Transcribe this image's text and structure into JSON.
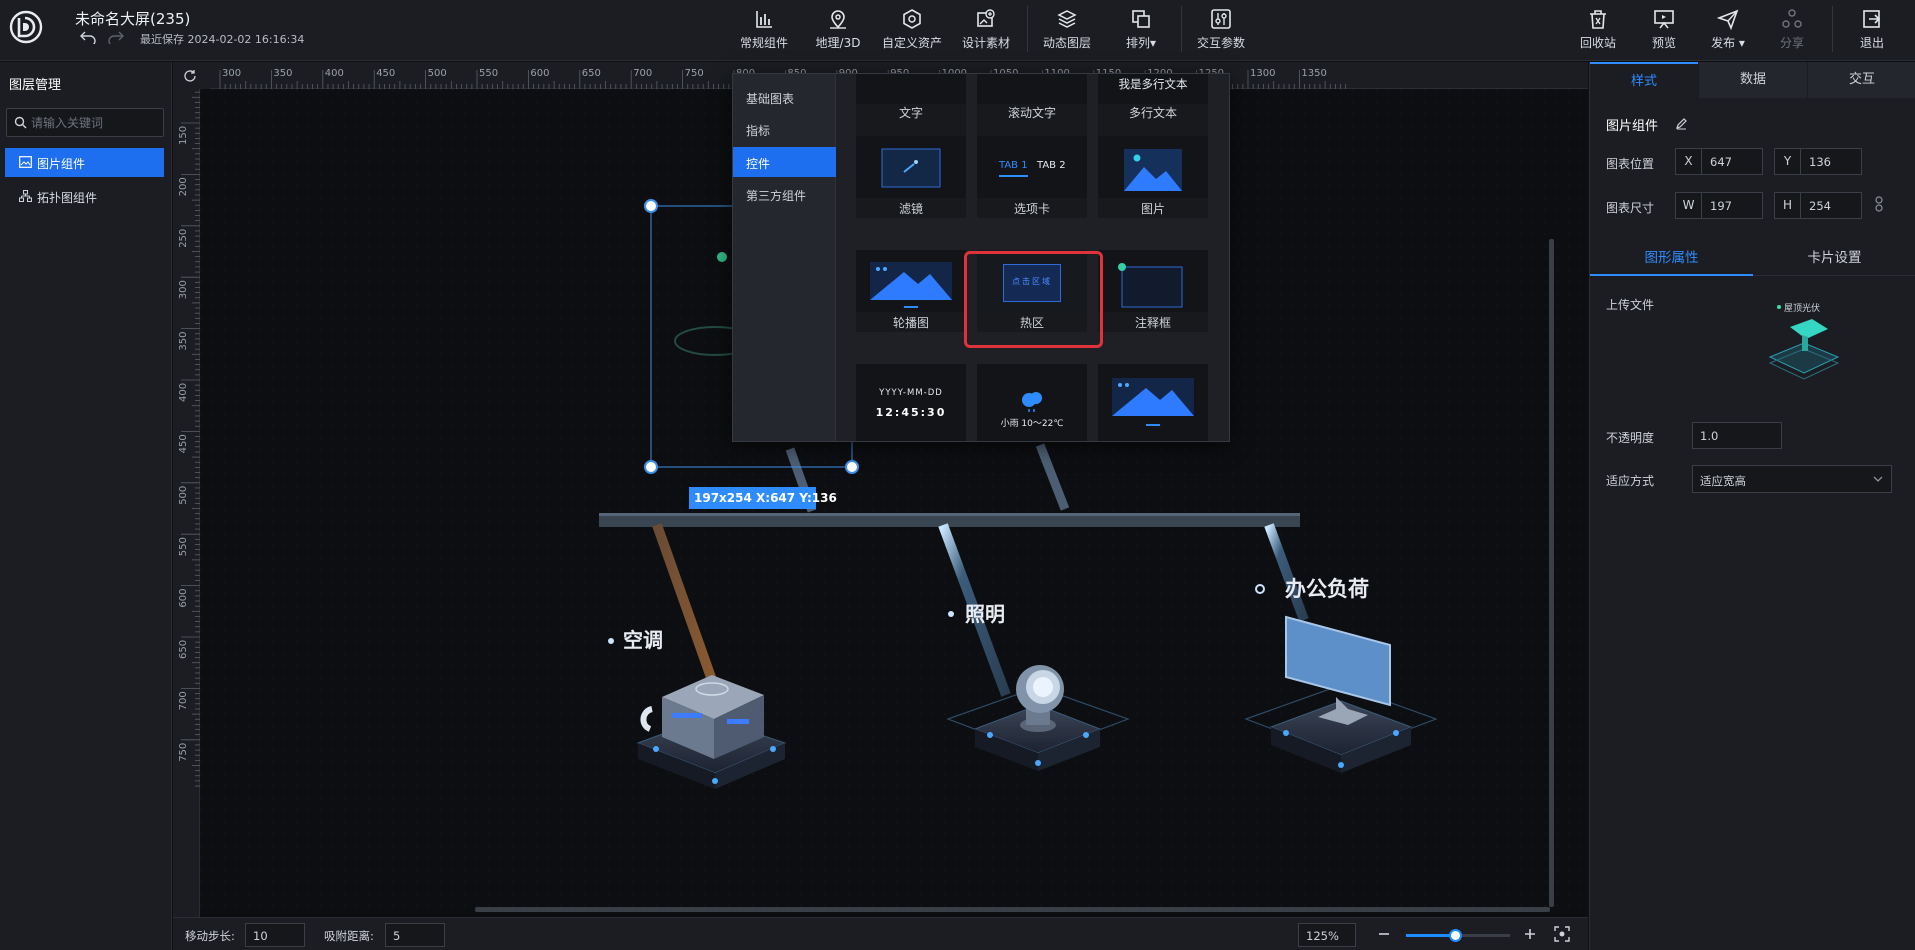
{
  "app": {
    "title": "未命名大屏(235)",
    "saved_text": "最近保存 2024-02-02 16:16:34"
  },
  "toolbar": {
    "center": [
      {
        "label": "常规组件",
        "icon": "bar-chart-icon"
      },
      {
        "label": "地理/3D",
        "icon": "map-pin-icon"
      },
      {
        "label": "自定义资产",
        "icon": "hexagon-icon"
      },
      {
        "label": "设计素材",
        "icon": "image-add-icon"
      },
      {
        "label": "动态图层",
        "icon": "layers-icon"
      },
      {
        "label": "排列▾",
        "icon": "arrange-icon"
      },
      {
        "label": "交互参数",
        "icon": "sliders-icon"
      }
    ],
    "right": [
      {
        "label": "回收站",
        "icon": "trash-icon"
      },
      {
        "label": "预览",
        "icon": "monitor-icon"
      },
      {
        "label": "发布 ▾",
        "icon": "send-icon"
      },
      {
        "label": "分享",
        "icon": "share-icon"
      },
      {
        "label": "退出",
        "icon": "exit-icon"
      }
    ]
  },
  "left_panel": {
    "title": "图层管理",
    "search_placeholder": "请输入关键词",
    "layers": [
      {
        "label": "图片组件",
        "active": true
      },
      {
        "label": "拓扑图组件",
        "active": false
      }
    ]
  },
  "ruler": {
    "x_ticks": [
      "300",
      "350",
      "400",
      "450",
      "500",
      "550",
      "600",
      "650",
      "700",
      "750",
      "800",
      "850",
      "900",
      "950",
      "1000",
      "1050",
      "1100",
      "1150",
      "1200",
      "1250",
      "1300",
      "1350"
    ],
    "y_ticks": [
      "150",
      "200",
      "250",
      "300",
      "350",
      "400",
      "450",
      "500",
      "550",
      "600",
      "650",
      "700",
      "750"
    ]
  },
  "canvas": {
    "selection_label": "197x254   X:647 Y:136",
    "nodes": [
      "空调",
      "照明",
      "办公负荷"
    ]
  },
  "popup": {
    "categories": [
      "基础图表",
      "指标",
      "控件",
      "第三方组件"
    ],
    "active_category": "控件",
    "cards": [
      {
        "label": "文字"
      },
      {
        "label": "滚动文字"
      },
      {
        "label": "多行文本",
        "preview": "我是多行文本"
      },
      {
        "label": "滤镜"
      },
      {
        "label": "选项卡",
        "preview": [
          "TAB 1",
          "TAB 2"
        ]
      },
      {
        "label": "图片"
      },
      {
        "label": "轮播图"
      },
      {
        "label": "热区",
        "preview": "点击区域"
      },
      {
        "label": "注释框"
      },
      {
        "label": "",
        "preview": [
          "YYYY-MM-DD",
          "12:45:30"
        ]
      },
      {
        "label": "",
        "preview": "小雨 10～22℃"
      },
      {
        "label": ""
      }
    ]
  },
  "status": {
    "step_label": "移动步长:",
    "step_value": "10",
    "snap_label": "吸附距离:",
    "snap_value": "5",
    "zoom_value": "125%",
    "zoom_level": 0.47
  },
  "right_panel": {
    "tabs": [
      "样式",
      "数据",
      "交互"
    ],
    "active_tab": "样式",
    "component_title": "图片组件",
    "position_label": "图表位置",
    "x_prefix": "X",
    "x_value": "647",
    "y_prefix": "Y",
    "y_value": "136",
    "size_label": "图表尺寸",
    "w_prefix": "W",
    "w_value": "197",
    "h_prefix": "H",
    "h_value": "254",
    "subtabs": [
      "图形属性",
      "卡片设置"
    ],
    "upload_label": "上传文件",
    "upload_caption": "屋顶光伏",
    "opacity_label": "不透明度",
    "opacity_value": "1.0",
    "fit_label": "适应方式",
    "fit_value": "适应宽高"
  },
  "colors": {
    "accent": "#1d6ff0",
    "highlight": "#e0323a",
    "selection": "#3d8fe8"
  }
}
